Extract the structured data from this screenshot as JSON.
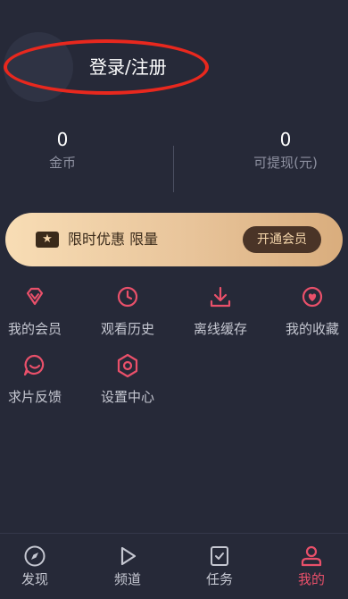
{
  "header": {
    "login_label": "登录/注册"
  },
  "stats": {
    "coins_value": "0",
    "coins_label": "金币",
    "withdraw_value": "0",
    "withdraw_label": "可提现(元)"
  },
  "vip_banner": {
    "text": "限时优惠 限量",
    "button_label": "开通会员"
  },
  "menu": [
    {
      "label": "我的会员",
      "icon": "diamond-icon"
    },
    {
      "label": "观看历史",
      "icon": "clock-icon"
    },
    {
      "label": "离线缓存",
      "icon": "download-icon"
    },
    {
      "label": "我的收藏",
      "icon": "heart-icon"
    },
    {
      "label": "求片反馈",
      "icon": "feedback-icon"
    },
    {
      "label": "设置中心",
      "icon": "settings-icon"
    }
  ],
  "tabbar": [
    {
      "label": "发现",
      "icon": "compass-icon"
    },
    {
      "label": "频道",
      "icon": "play-icon"
    },
    {
      "label": "任务",
      "icon": "task-icon"
    },
    {
      "label": "我的",
      "icon": "profile-icon",
      "active": true
    }
  ],
  "colors": {
    "background": "#262938",
    "accent": "#e9506a",
    "annotation": "#e8281e",
    "vip_gold": "#f0cfa3"
  }
}
